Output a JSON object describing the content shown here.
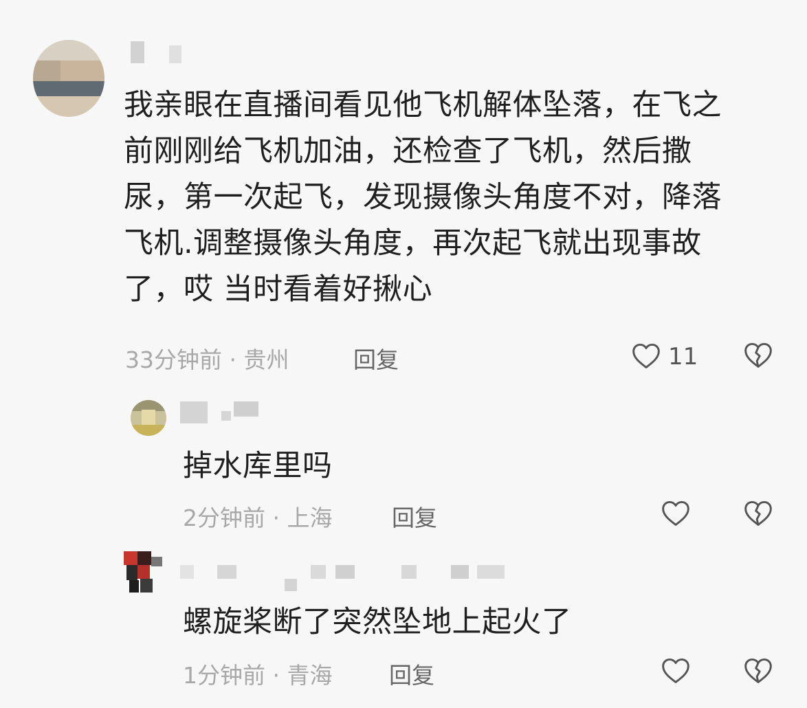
{
  "comments": [
    {
      "text_lines": [
        "我亲眼在直播间看见他飞机解体坠落，在飞之",
        "前刚刚给飞机加油，还检查了飞机，然后撒",
        "尿，第一次起飞，发现摄像头角度不对，降落",
        "飞机.调整摄像头角度，再次起飞就出现事故",
        "了，哎  当时看着好揪心"
      ],
      "meta": "33分钟前 · 贵州",
      "reply_label": "回复",
      "like_count": "11"
    },
    {
      "text_lines": [
        "掉水库里吗"
      ],
      "meta": "2分钟前 · 上海",
      "reply_label": "回复"
    },
    {
      "text_lines": [
        "螺旋桨断了突然坠地上起火了"
      ],
      "meta": "1分钟前 · 青海",
      "reply_label": "回复"
    }
  ],
  "icons": {
    "like": "heart-outline-icon",
    "dislike": "broken-heart-icon"
  },
  "colors": {
    "background": "#f7f7f7",
    "text": "#1f1f1f",
    "meta": "#a8a8a8",
    "icon": "#555555"
  }
}
